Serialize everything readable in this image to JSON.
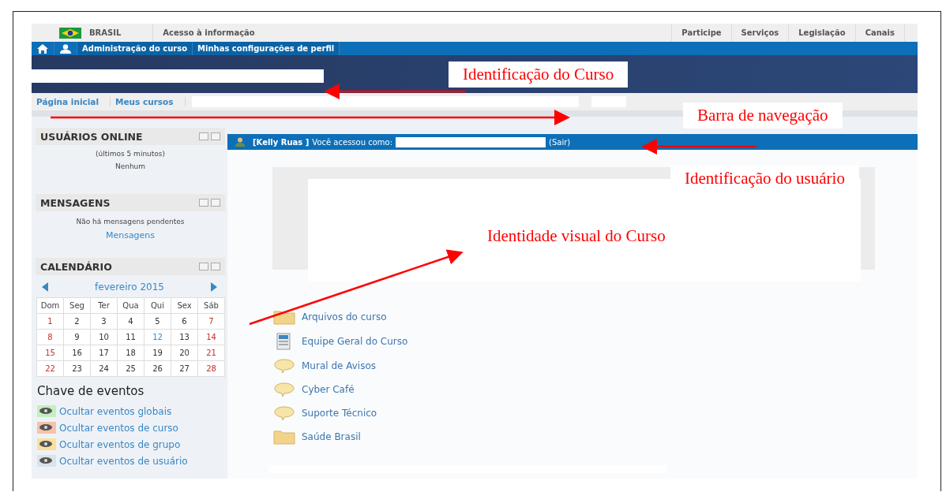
{
  "gov_bar": {
    "country": "BRASIL",
    "link": "Acesso à informação",
    "menu": [
      "Participe",
      "Serviços",
      "Legislação",
      "Canais"
    ]
  },
  "nav_bar": {
    "items": [
      "Administração do curso",
      "Minhas configurações de perfil"
    ]
  },
  "breadcrumb": [
    "Página inicial",
    "Meus cursos"
  ],
  "online_block": {
    "title": "USUÁRIOS ONLINE",
    "lines": [
      "(últimos 5 minutos)",
      "Nenhum"
    ]
  },
  "messages_block": {
    "title": "MENSAGENS",
    "text": "Não há mensagens pendentes",
    "link": "Mensagens"
  },
  "calendar_block": {
    "title": "CALENDÁRIO",
    "month": "fevereiro 2015",
    "weekdays": [
      "Dom",
      "Seg",
      "Ter",
      "Qua",
      "Qui",
      "Sex",
      "Sáb"
    ],
    "weeks": [
      [
        {
          "day": "1",
          "kind": "weekend"
        },
        {
          "day": "2",
          "kind": "normal"
        },
        {
          "day": "3",
          "kind": "normal"
        },
        {
          "day": "4",
          "kind": "normal"
        },
        {
          "day": "5",
          "kind": "normal"
        },
        {
          "day": "6",
          "kind": "normal"
        },
        {
          "day": "7",
          "kind": "weekend"
        }
      ],
      [
        {
          "day": "8",
          "kind": "weekend"
        },
        {
          "day": "9",
          "kind": "normal"
        },
        {
          "day": "10",
          "kind": "normal"
        },
        {
          "day": "11",
          "kind": "normal"
        },
        {
          "day": "12",
          "kind": "event"
        },
        {
          "day": "13",
          "kind": "normal"
        },
        {
          "day": "14",
          "kind": "weekend"
        }
      ],
      [
        {
          "day": "15",
          "kind": "weekend"
        },
        {
          "day": "16",
          "kind": "normal"
        },
        {
          "day": "17",
          "kind": "normal"
        },
        {
          "day": "18",
          "kind": "normal"
        },
        {
          "day": "19",
          "kind": "normal"
        },
        {
          "day": "20",
          "kind": "normal"
        },
        {
          "day": "21",
          "kind": "weekend"
        }
      ],
      [
        {
          "day": "22",
          "kind": "weekend"
        },
        {
          "day": "23",
          "kind": "normal"
        },
        {
          "day": "24",
          "kind": "normal"
        },
        {
          "day": "25",
          "kind": "normal"
        },
        {
          "day": "26",
          "kind": "normal"
        },
        {
          "day": "27",
          "kind": "normal"
        },
        {
          "day": "28",
          "kind": "weekend"
        }
      ]
    ],
    "event_key_title": "Chave de eventos",
    "event_key": [
      {
        "label": "Ocultar eventos globais",
        "color": "#c6efbf"
      },
      {
        "label": "Ocultar eventos de curso",
        "color": "#f6c1ad"
      },
      {
        "label": "Ocultar eventos de grupo",
        "color": "#fbe09a"
      },
      {
        "label": "Ocultar eventos de usuário",
        "color": "#dbe3ea"
      }
    ]
  },
  "user_bar": {
    "name": "[Kelly Ruas ]",
    "text": "Você acessou como:",
    "logout": "(Sair)"
  },
  "activities": [
    {
      "label": "Arquivos do curso",
      "kind": "folder"
    },
    {
      "label": "Equipe Geral do Curso",
      "kind": "page"
    },
    {
      "label": "Mural de Avisos",
      "kind": "forum"
    },
    {
      "label": "Cyber Café",
      "kind": "forum"
    },
    {
      "label": "Suporte Técnico",
      "kind": "forum"
    },
    {
      "label": "Saúde Brasil",
      "kind": "folder"
    }
  ],
  "annotations": [
    {
      "text": "Identificação do Curso"
    },
    {
      "text": "Barra de navegação"
    },
    {
      "text": "Identificação do usuário"
    },
    {
      "text": "Identidade visual do Curso"
    }
  ]
}
